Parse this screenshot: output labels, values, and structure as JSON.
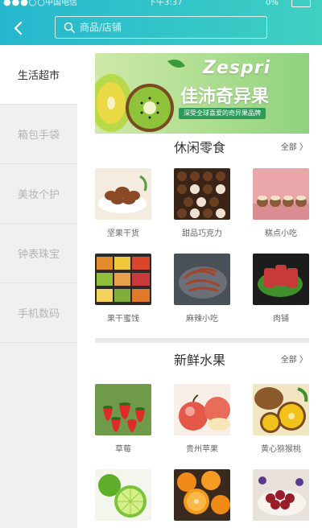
{
  "status_bar": {
    "carrier": "中国电信",
    "time": "下午3:37",
    "battery": "0%"
  },
  "search": {
    "placeholder": "商品/店铺"
  },
  "sidebar": {
    "items": [
      {
        "label": "生活超市",
        "active": true
      },
      {
        "label": "箱包手袋",
        "active": false
      },
      {
        "label": "美妆个护",
        "active": false
      },
      {
        "label": "钟表珠宝",
        "active": false
      },
      {
        "label": "手机数码",
        "active": false
      }
    ]
  },
  "banner": {
    "brand": "Zespri",
    "title": "佳沛奇异果",
    "subtitle": "深受全球喜爱的奇异果品牌"
  },
  "sections": [
    {
      "title": "休闲零食",
      "more": "全部 〉",
      "products": [
        {
          "name": "坚果干货"
        },
        {
          "name": "甜品巧克力"
        },
        {
          "name": "糕点小吃"
        },
        {
          "name": "果干蜜饯"
        },
        {
          "name": "麻辣小吃"
        },
        {
          "name": "肉铺"
        }
      ]
    },
    {
      "title": "新鲜水果",
      "more": "全部 〉",
      "products": [
        {
          "name": "草莓"
        },
        {
          "name": "贵州苹果"
        },
        {
          "name": "黄心猕猴桃"
        },
        {
          "name": ""
        },
        {
          "name": ""
        },
        {
          "name": ""
        }
      ]
    }
  ],
  "colors": {
    "header_start": "#26b7cf",
    "header_end": "#3fd0c2",
    "sidebar_bg": "#f0f0f0",
    "active_text": "#333333",
    "inactive_text": "#b5b5b5"
  }
}
